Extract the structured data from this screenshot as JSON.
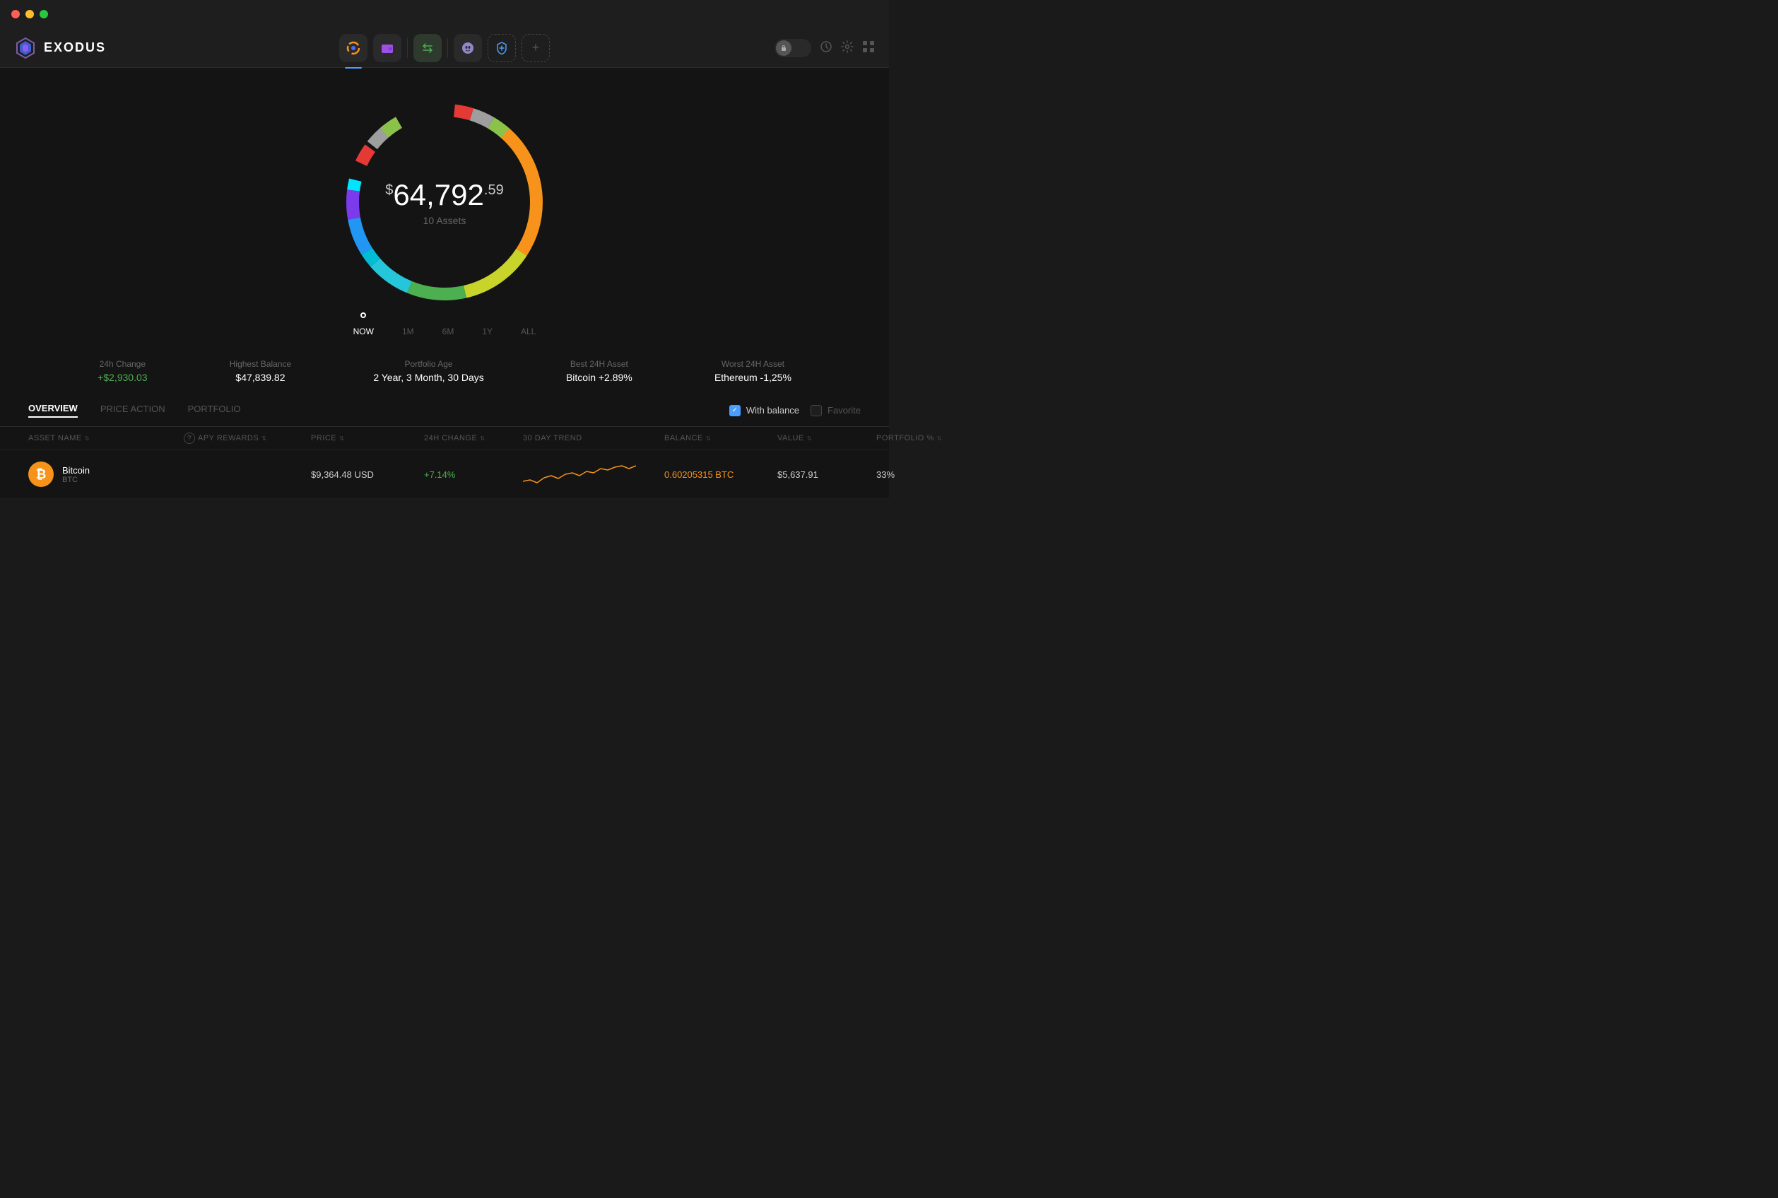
{
  "titlebar": {
    "dots": [
      "red",
      "yellow",
      "green"
    ]
  },
  "logo": {
    "text": "EXODUS"
  },
  "nav": {
    "icons": [
      "portfolio",
      "wallet",
      "exchange",
      "phantom",
      "shield-plus",
      "add"
    ],
    "right": [
      "lock",
      "history",
      "settings",
      "grid"
    ]
  },
  "portfolio": {
    "total_dollar": "$",
    "total_main": "64,792",
    "total_cents": ".59",
    "assets_count": "10 Assets",
    "timeline": [
      "NOW",
      "1M",
      "6M",
      "1Y",
      "ALL"
    ],
    "stats": [
      {
        "label": "24h Change",
        "value": "+$2,930.03",
        "type": "positive"
      },
      {
        "label": "Highest Balance",
        "value": "$47,839.82",
        "type": "normal"
      },
      {
        "label": "Portfolio Age",
        "value": "2 Year, 3 Month, 30 Days",
        "type": "normal"
      },
      {
        "label": "Best 24H Asset",
        "value": "Bitcoin +2.89%",
        "type": "normal"
      },
      {
        "label": "Worst 24H Asset",
        "value": "Ethereum -1,25%",
        "type": "normal"
      }
    ]
  },
  "tabs": {
    "items": [
      "OVERVIEW",
      "PRICE ACTION",
      "PORTFOLIO"
    ],
    "active": 0,
    "filters": {
      "with_balance_label": "With balance",
      "favorite_label": "Favorite"
    }
  },
  "table": {
    "headers": [
      {
        "label": "ASSET NAME",
        "sortable": true
      },
      {
        "label": "APY REWARDS",
        "sortable": true,
        "has_info": true
      },
      {
        "label": "PRICE",
        "sortable": true
      },
      {
        "label": "24H CHANGE",
        "sortable": true
      },
      {
        "label": "30 DAY TREND"
      },
      {
        "label": "BALANCE",
        "sortable": true
      },
      {
        "label": "VALUE",
        "sortable": true
      },
      {
        "label": "PORTFOLIO %",
        "sortable": true
      }
    ],
    "rows": [
      {
        "icon": "₿",
        "icon_bg": "btc",
        "name": "Bitcoin",
        "symbol": "BTC",
        "apy": "",
        "price": "$9,364.48 USD",
        "change": "+7.14%",
        "change_type": "positive",
        "balance": "0.60205315 BTC",
        "value": "$5,637.91",
        "portfolio": "33%"
      }
    ]
  }
}
